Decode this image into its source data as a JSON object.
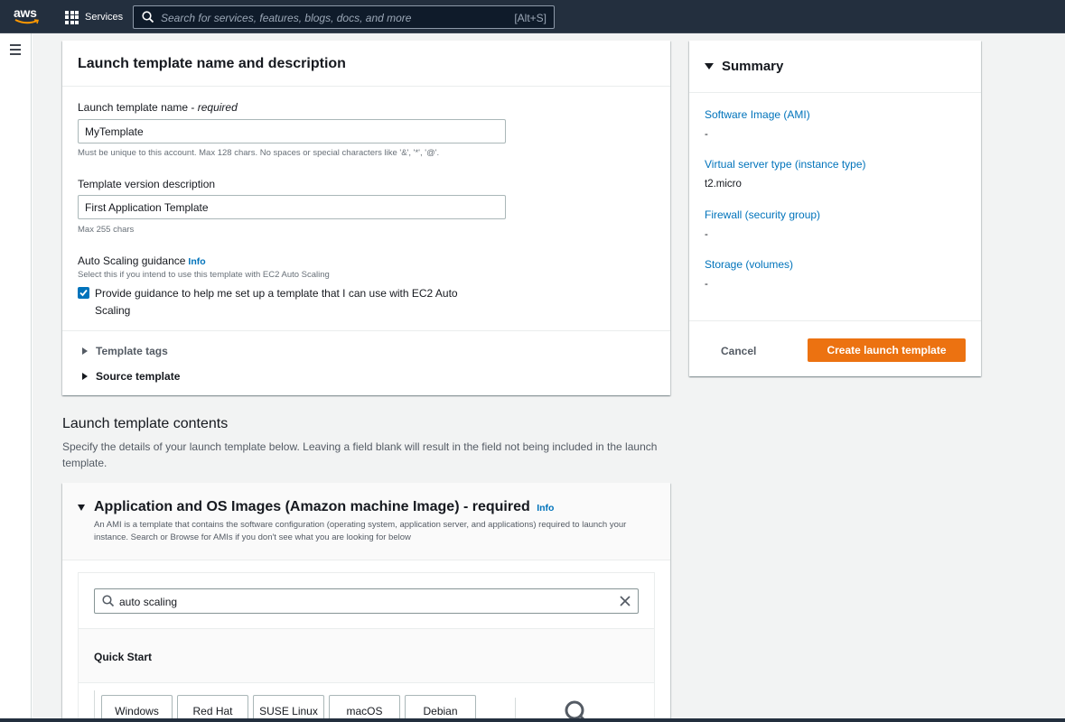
{
  "topnav": {
    "logo_text": "aws",
    "services_label": "Services",
    "search_placeholder": "Search for services, features, blogs, docs, and more",
    "search_shortcut": "[Alt+S]"
  },
  "form": {
    "heading": "Launch template name and description",
    "name_label": "Launch template name - ",
    "name_required": "required",
    "name_value": "MyTemplate",
    "name_hint": "Must be unique to this account. Max 128 chars. No spaces or special characters like '&', '*', '@'.",
    "version_label": "Template version description",
    "version_value": "First Application Template",
    "version_hint": "Max 255 chars",
    "asg_label": "Auto Scaling guidance",
    "asg_info": "Info",
    "asg_hint": "Select this if you intend to use this template with EC2 Auto Scaling",
    "asg_checkbox_text": "Provide guidance to help me set up a template that I can use with EC2 Auto Scaling",
    "asg_checked": true,
    "template_tags": "Template tags",
    "source_template": "Source template"
  },
  "summary": {
    "heading": "Summary",
    "items": [
      {
        "label": "Software Image (AMI)",
        "value": "-"
      },
      {
        "label": "Virtual server type (instance type)",
        "value": "t2.micro"
      },
      {
        "label": "Firewall (security group)",
        "value": "-"
      },
      {
        "label": "Storage (volumes)",
        "value": "-"
      }
    ],
    "cancel_label": "Cancel",
    "create_label": "Create launch template",
    "accent_color": "#ec7211"
  },
  "contents": {
    "title": "Launch template contents",
    "description": "Specify the details of your launch template below. Leaving a field blank will result in the field not being included in the launch template."
  },
  "ami": {
    "title": "Application and OS Images (Amazon machine Image) - required",
    "info": "Info",
    "description": "An AMI is a template that contains the software configuration (operating system, application server, and applications) required to launch your instance. Search or Browse for AMIs if you don't see what you are looking for below",
    "search_value": "auto scaling",
    "quick_start_label": "Quick Start",
    "os_tabs": [
      "Windows",
      "Red Hat",
      "SUSE Linux",
      "macOS",
      "Debian"
    ]
  }
}
